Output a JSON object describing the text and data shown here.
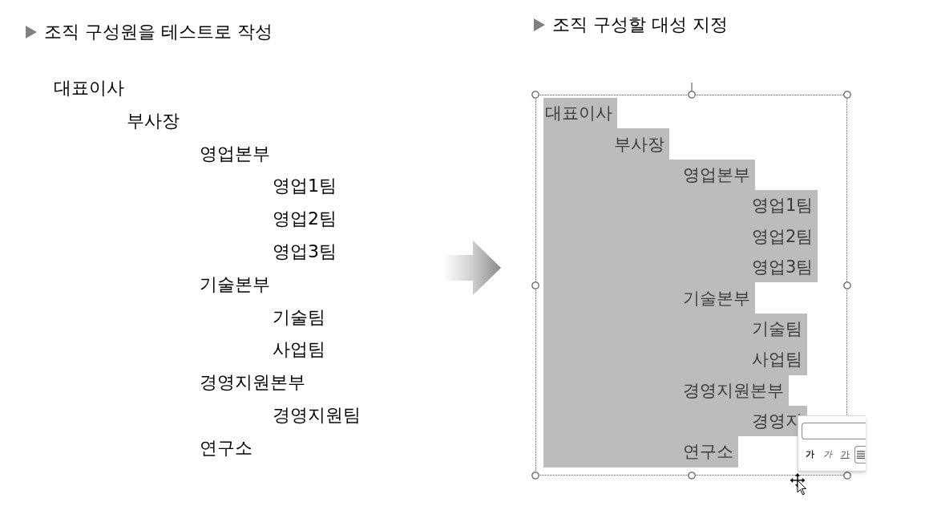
{
  "left_panel": {
    "heading": "조직 구성원을 테스트로 작성",
    "tree": [
      {
        "label": "대표이사",
        "children": [
          {
            "label": "부사장",
            "children": [
              {
                "label": "영업본부",
                "children": [
                  {
                    "label": "영업1팀"
                  },
                  {
                    "label": "영업2팀"
                  },
                  {
                    "label": "영업3팀"
                  }
                ]
              },
              {
                "label": "기술본부",
                "children": [
                  {
                    "label": "기술팀"
                  },
                  {
                    "label": "사업팀"
                  }
                ]
              },
              {
                "label": "경영지원본부",
                "children": [
                  {
                    "label": "경영지원팀"
                  }
                ]
              },
              {
                "label": "연구소"
              }
            ]
          }
        ]
      }
    ]
  },
  "right_panel": {
    "heading": "조직 구성할 대성 지정",
    "text_box": {
      "selected": true,
      "text_highlighted": true,
      "lines": [
        {
          "label": "대표이사",
          "children": [
            {
              "label": "부사장",
              "children": [
                {
                  "label": "영업본부",
                  "children": [
                    {
                      "label": "영업1팀"
                    },
                    {
                      "label": "영업2팀"
                    },
                    {
                      "label": "영업3팀"
                    }
                  ]
                },
                {
                  "label": "기술본부",
                  "children": [
                    {
                      "label": "기술팀"
                    },
                    {
                      "label": "사업팀"
                    }
                  ]
                },
                {
                  "label": "경영지원본부",
                  "children": [
                    {
                      "label": "경영지"
                    }
                  ]
                },
                {
                  "label": "연구소"
                }
              ]
            }
          ]
        }
      ]
    }
  },
  "mini_toolbar": {
    "buttons": [
      {
        "kind": "bold",
        "label": "가"
      },
      {
        "kind": "italic",
        "label": "가"
      },
      {
        "kind": "underline",
        "label": "가"
      },
      {
        "kind": "list"
      }
    ]
  }
}
